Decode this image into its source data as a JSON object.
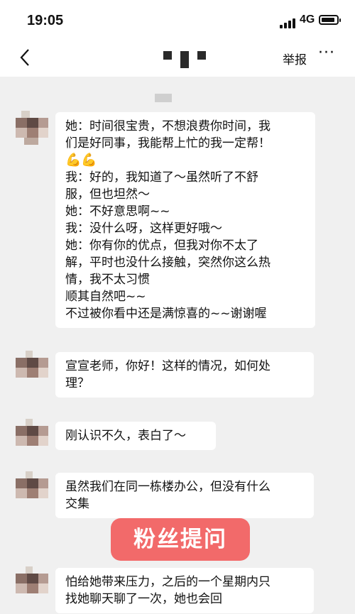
{
  "status_bar": {
    "time": "19:05",
    "network": "4G"
  },
  "nav": {
    "report_label": "举报",
    "more_label": "···"
  },
  "messages": [
    {
      "lines": [
        "她：时间很宝贵，不想浪费你时间，我",
        "们是好同事，我能帮上忙的我一定帮！",
        "💪💪",
        "我：好的，我知道了～虽然听了不舒",
        "服，但也坦然～",
        "她：不好意思啊~~",
        "我：没什么呀，这样更好哦～",
        "她：你有你的优点，但我对你不太了",
        "解，平时也没什么接触，突然你这么热",
        "情，我不太习惯",
        "顺其自然吧~~",
        "不过被你看中还是满惊喜的~~谢谢喔"
      ]
    },
    {
      "lines": [
        "宣宣老师，你好！这样的情况，如何处",
        "理？"
      ]
    },
    {
      "lines": [
        "刚认识不久，表白了～"
      ]
    },
    {
      "lines": [
        "虽然我们在同一栋楼办公，但没有什么",
        "交集"
      ]
    },
    {
      "lines": [
        "怕给她带来压力，之后的一个星期内只",
        "找她聊天聊了一次，她也会回"
      ]
    }
  ],
  "overlay_tag": {
    "label": "粉丝提问",
    "color": "#f26a6a"
  }
}
